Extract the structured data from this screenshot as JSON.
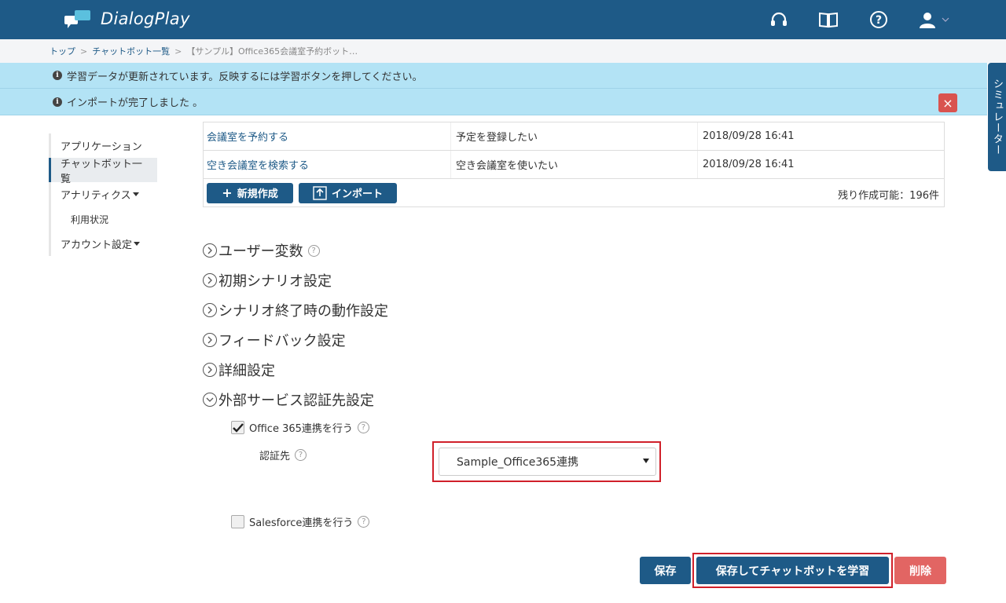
{
  "app": {
    "logo_text": "DialogPlay"
  },
  "header_icons": [
    "headset-icon",
    "book-icon",
    "help-icon",
    "user-icon"
  ],
  "breadcrumb": {
    "top": "トップ",
    "list": "チャットボット一覧",
    "current": "【サンプル】Office365会議室予約ボット…",
    "sep": ">"
  },
  "alerts": {
    "learning": "学習データが更新されています。反映するには学習ボタンを押してください。",
    "import": "インポートが完了しました 。",
    "close_label": "×"
  },
  "simulator_tab": "シミュレーター",
  "sidebar": {
    "items": [
      {
        "label": "アプリケーション"
      },
      {
        "label": "チャットボット一覧"
      },
      {
        "label": "アナリティクス"
      },
      {
        "label": "利用状況"
      },
      {
        "label": "アカウント設定"
      }
    ]
  },
  "table": {
    "rows": [
      {
        "name": "会議室を予約する",
        "desc": "予定を登録したい",
        "date": "2018/09/28 16:41"
      },
      {
        "name": "空き会議室を検索する",
        "desc": "空き会議室を使いたい",
        "date": "2018/09/28 16:41"
      }
    ],
    "new_button": "新規作成",
    "import_button": "インポート",
    "remaining": "残り作成可能：196件"
  },
  "sections": [
    {
      "label": "ユーザー変数",
      "help": "?"
    },
    {
      "label": "初期シナリオ設定"
    },
    {
      "label": "シナリオ終了時の動作設定"
    },
    {
      "label": "フィードバック設定"
    },
    {
      "label": "詳細設定"
    },
    {
      "label": "外部サービス認証先設定"
    }
  ],
  "office365": {
    "checkbox_label": "Office 365連携を行う",
    "checked": true,
    "auth_label": "認証先",
    "auth_value": "Sample_Office365連携"
  },
  "salesforce": {
    "checkbox_label": "Salesforce連携を行う",
    "checked": false
  },
  "buttons": {
    "save": "保存",
    "save_learn": "保存してチャットボットを学習",
    "delete": "削除"
  },
  "colors": {
    "primary": "#1e5a87",
    "alert_bg": "#b3e3f5",
    "danger": "#d9534f",
    "highlight": "#d0202a"
  }
}
